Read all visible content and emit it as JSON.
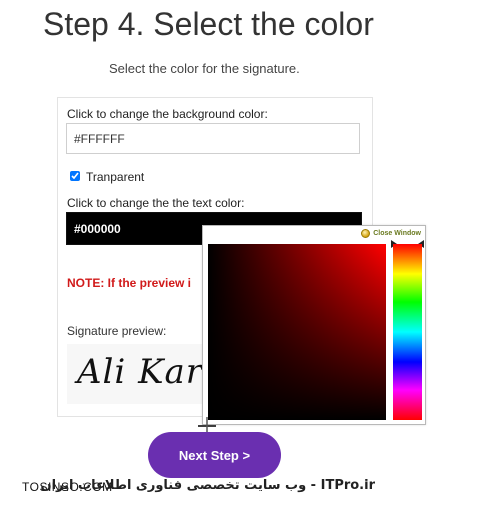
{
  "header": {
    "title": "Step 4. Select the color",
    "subtitle": "Select the color for the signature."
  },
  "form": {
    "bg_label": "Click to change the background color:",
    "bg_value": "#FFFFFF",
    "transparent_label": "Tranparent",
    "transparent_checked": true,
    "text_label": "Click to change the the text color:",
    "text_value": "#000000",
    "note": "NOTE: If the preview i",
    "preview_label": "Signature preview:",
    "signature_text": "Ali Kar"
  },
  "picker": {
    "close_label": "Close Window",
    "hue_color": "#ff0000"
  },
  "actions": {
    "next_label": "Next Step >"
  },
  "watermark": {
    "left": "TOSINSO.COM",
    "right": "ITPro.ir - وب سایت تخصصی فناوری اطلاعات ایران"
  },
  "colors": {
    "accent": "#6a2fb0",
    "note": "#d11a1a"
  }
}
